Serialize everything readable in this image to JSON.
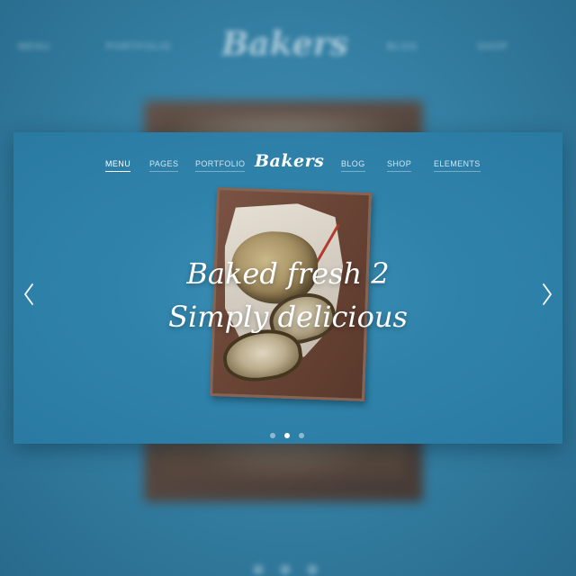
{
  "background": {
    "nav_items": [
      "MENU",
      "PORTFOLIO",
      "BLOG",
      "SHOP"
    ],
    "logo": "Bakers"
  },
  "header": {
    "logo": "Bakers",
    "nav": [
      {
        "label": "MENU",
        "active": true
      },
      {
        "label": "PAGES",
        "active": false
      },
      {
        "label": "PORTFOLIO",
        "active": false
      },
      {
        "label": "BLOG",
        "active": false
      },
      {
        "label": "SHOP",
        "active": false
      },
      {
        "label": "ELEMENTS",
        "active": false
      }
    ]
  },
  "slide": {
    "headline_line1": "Baked fresh 2",
    "headline_line2": "Simply delicious",
    "active_index": 2,
    "total": 3
  },
  "controls": {
    "prev_icon": "chevron-left-icon",
    "next_icon": "chevron-right-icon"
  },
  "colors": {
    "accent": "#2f83ab",
    "text": "#ffffff",
    "board": "#6a4536"
  }
}
